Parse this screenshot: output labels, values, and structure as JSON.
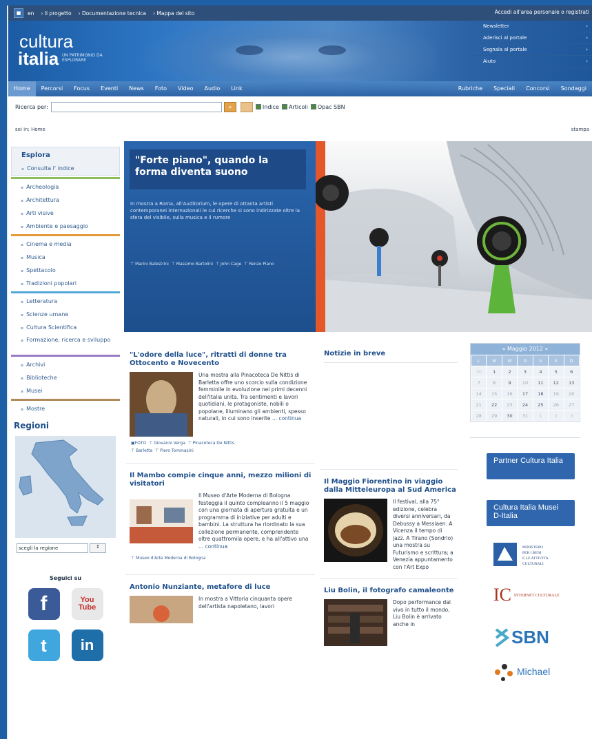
{
  "topbar": {
    "flag_label": "■",
    "links": [
      "en",
      "Il progetto",
      "Documentazione tecnica",
      "Mappa del sito"
    ],
    "right_text": "Accedi all'area personale o registrati"
  },
  "header": {
    "logo_line1": "cultura",
    "logo_line2": "italia",
    "tagline": "UN PATRIMONIO DA ESPLORARE",
    "menu": [
      "Newsletter",
      "Aderisci al portale",
      "Segnala al portale",
      "Aiuto"
    ]
  },
  "nav": {
    "left": [
      "Home",
      "Percorsi",
      "Focus",
      "Eventi",
      "News",
      "Foto",
      "Video",
      "Audio",
      "Link"
    ],
    "right": [
      "Rubriche",
      "Speciali",
      "Concorsi",
      "Sondaggi"
    ]
  },
  "search": {
    "label": "Ricerca per:",
    "value": "",
    "go_label": "»",
    "checks": [
      "Indice",
      "Articoli",
      "Opac SBN"
    ]
  },
  "breadcrumb": "sei in: Home",
  "breadcrumb_right": "stampa",
  "sidebar": {
    "title": "Esplora",
    "consulta": "Consulta l' indice",
    "groups": [
      {
        "color": "#8bbf5a",
        "items": [
          "Archeologia",
          "Architettura",
          "Arti visive",
          "Ambiente e paesaggio"
        ]
      },
      {
        "color": "#e59a3b",
        "items": [
          "Cinema e media",
          "Musica",
          "Spettacolo",
          "Tradizioni popolari"
        ]
      },
      {
        "color": "#52a7d8",
        "items": [
          "Letteratura",
          "Scienze umane",
          "Cultura Scientifica",
          "Formazione, ricerca e sviluppo"
        ]
      },
      {
        "color": "#9a7cc6",
        "items": [
          "Archivi",
          "Biblioteche",
          "Musei"
        ]
      },
      {
        "color": "#b08a5a",
        "items": [
          "Mostre"
        ]
      }
    ],
    "regioni_title": "Regioni",
    "select_label": "scegli la regione",
    "select_arrow": "↕",
    "seguici": "Seguici su",
    "social": [
      {
        "name": "facebook-icon",
        "label": "f",
        "color": "#3b5a98"
      },
      {
        "name": "youtube-icon",
        "label": "You Tube",
        "color": "#c4302b"
      },
      {
        "name": "twitter-icon",
        "label": "t",
        "color": "#3fa7dd"
      },
      {
        "name": "linkedin-icon",
        "label": "in",
        "color": "#1e6ea9"
      }
    ]
  },
  "hero": {
    "title": "\"Forte piano\", quando la forma diventa suono",
    "summary": "In mostra a Roma, all'Auditorium, le opere di ottanta artisti contemporanei internazionali le cui ricerche si sono indirizzate oltre la sfera del visibile, sulla musica e il rumore",
    "tags": [
      "Marini Balestrini",
      "Massimo Bartolini",
      "John Cage",
      "Renzo Piano"
    ]
  },
  "articles_col1": [
    {
      "title": "\"L'odore della luce\", ritratti di donne tra Ottocento e Novecento",
      "body": "Una mostra alla Pinacoteca De Nittis di Barletta offre uno scorcio sulla condizione femminile in evoluzione nei primi decenni dell'Italia unita. Tra sentimenti e lavori quotidiani, le protagoniste, nobili o popolane, illuminano gli ambienti, spesso naturali, in cui sono inserite ...",
      "more": "continua",
      "tags": [
        "FOTO",
        "Giovanni Verga",
        "Pinacoteca De Nittis",
        "Barletta",
        "Piero Tommasini"
      ]
    },
    {
      "title": "Il Mambo compie cinque anni, mezzo milioni di visitatori",
      "body": "Il Museo d'Arte Moderna di Bologna festeggia il quinto compleanno il 5 maggio con una giornata di apertura gratuita e un programma di iniziative per adulti e bambini. La struttura ha riordinato la sua collezione permanente, comprendente oltre quattromila opere, e ha all'attivo una ...",
      "more": "continua",
      "tags": [
        "Museo d'Arte Moderna di Bologna"
      ]
    },
    {
      "title": "Antonio Nunziante, metafore di luce",
      "body": "In mostra a Vittoria cinquanta opere dell'artista napoletano, lavori",
      "more": "",
      "tags": []
    }
  ],
  "col2": {
    "heading": "Notizie in breve",
    "articles": [
      {
        "title": "Il Maggio Fiorentino in viaggio dalla Mitteleuropa al Sud America",
        "body": "Il festival, alla 75° edizione, celebra diversi anniversari, da Debussy a Messiaen. A Vicenza il tempo di jazz. A Tirano (Sondrio) una mostra su Futurismo e scrittura; a Venezia appuntamento con l'Art Expo"
      },
      {
        "title": "Liu Bolin, il fotografo camaleonte",
        "body": "Dopo performance dal vivo in tutto il mondo, Liu Bolin è arrivato anche in"
      }
    ]
  },
  "calendar": {
    "title": "« Maggio 2012 »",
    "dow": [
      "L",
      "M",
      "M",
      "G",
      "V",
      "S",
      "D"
    ],
    "weeks": [
      [
        "30",
        "1",
        "2",
        "3",
        "4",
        "5",
        "6"
      ],
      [
        "7",
        "8",
        "9",
        "10",
        "11",
        "12",
        "13"
      ],
      [
        "14",
        "15",
        "16",
        "17",
        "18",
        "19",
        "20"
      ],
      [
        "21",
        "22",
        "23",
        "24",
        "25",
        "26",
        "27"
      ],
      [
        "28",
        "29",
        "30",
        "31",
        "1",
        "2",
        "3"
      ]
    ]
  },
  "partners": {
    "p1": "Partner Cultura Italia",
    "p2": "Cultura Italia Musei D-Italia",
    "logos": [
      "MINISTERO PER I BENI E LE ATTIVITÀ CULTURALI",
      "INTERNET CULTURALE",
      "SBN",
      "Michael"
    ]
  }
}
